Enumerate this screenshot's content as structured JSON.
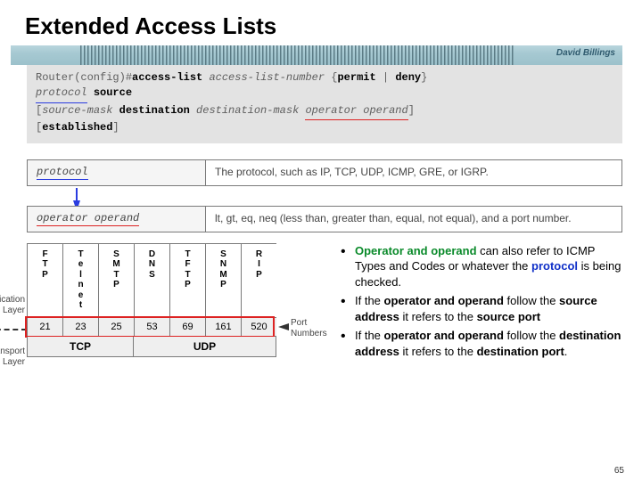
{
  "title": "Extended Access Lists",
  "author": "David Billings",
  "syntax": {
    "line1_prefix": "Router(config)#",
    "line1_cmd": "access-list",
    "line1_num": "access-list-number",
    "line1_permit": "permit",
    "line1_pipe": " | ",
    "line1_deny": "deny",
    "line2_protocol": "protocol",
    "line2_source": "source",
    "line3_srcmask": "source-mask",
    "line3_dest": "destination",
    "line3_destmask": "destination-mask",
    "line3_op": "operator operand",
    "line4_lb": "[",
    "line4_est": "established",
    "line4_rb": "]"
  },
  "info1": {
    "left": "protocol",
    "right": "The protocol, such as IP, TCP, UDP, ICMP, GRE, or IGRP."
  },
  "info2": {
    "left": "operator operand",
    "right": "lt, gt, eq, neq (less than, greater than, equal, not equal), and a port number."
  },
  "ports": {
    "cols": [
      {
        "hdr": "F\nT\nP",
        "num": "21"
      },
      {
        "hdr": "T\ne\nl\nn\ne\nt",
        "num": "23"
      },
      {
        "hdr": "S\nM\nT\nP",
        "num": "25"
      },
      {
        "hdr": "D\nN\nS",
        "num": "53"
      },
      {
        "hdr": "T\nF\nT\nP",
        "num": "69"
      },
      {
        "hdr": "S\nN\nM\nP",
        "num": "161"
      },
      {
        "hdr": "R\nI\nP",
        "num": "520"
      }
    ],
    "app_label": "Application\nLayer",
    "trans_label": "Transport\nLayer",
    "port_label": "Port\nNumbers",
    "tcp": "TCP",
    "udp": "UDP"
  },
  "bullets": {
    "b1_op": "Operator and operand",
    "b1_rest": " can also refer to ICMP Types and Codes or whatever the ",
    "b1_proto": "protocol",
    "b1_end": " is being checked.",
    "b2_pre": "If the ",
    "b2_op": "operator and operand",
    "b2_mid": " follow the ",
    "b2_src": "source address",
    "b2_mid2": " it refers to the ",
    "b2_sp": "source port",
    "b3_pre": "If the ",
    "b3_op": "operator and operand",
    "b3_mid": " follow the ",
    "b3_dst": "destination address",
    "b3_mid2": " it refers to the ",
    "b3_dp": "destination port",
    "b3_dot": "."
  },
  "page": "65"
}
